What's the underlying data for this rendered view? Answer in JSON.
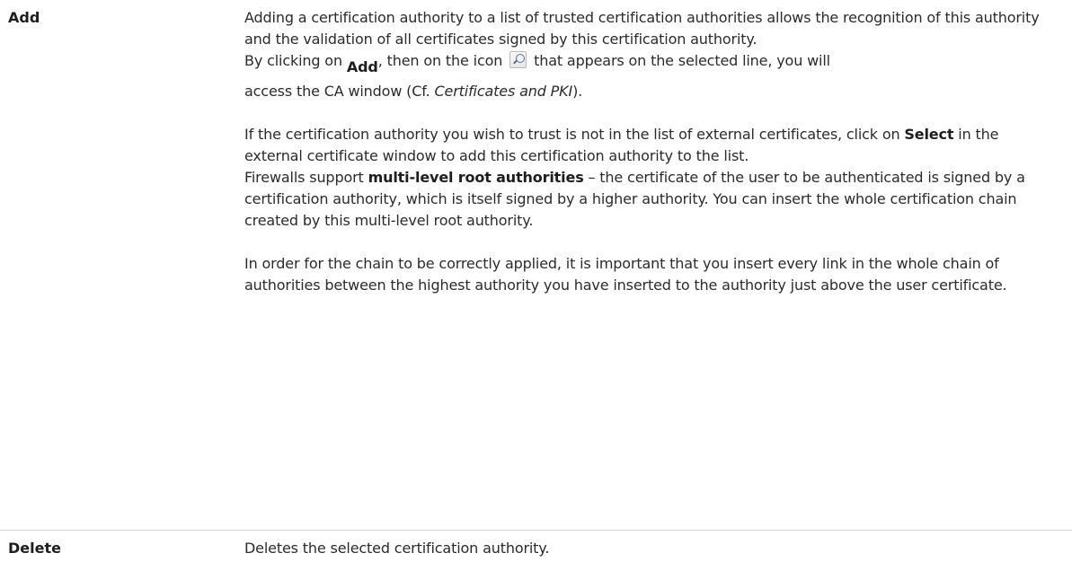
{
  "rows": [
    {
      "term": "Add",
      "p1": "Adding a certification authority to a list of trusted certification authorities allows the recognition of this authority and the validation of all certificates signed by this certification authority.",
      "p2_before": "By clicking on ",
      "p2_add": "Add",
      "p2_after_add": ", then on the icon ",
      "p2_after_icon": " that appears on the selected line, you will",
      "p3_before": "access the CA window (Cf. ",
      "p3_italic": "Certificates and PKI",
      "p3_after": ").",
      "p4_before": "If the certification authority you wish to trust is not in the list of external certificates, click on ",
      "p4_bold": "Select",
      "p4_after": " in the external certificate window to add this certification authority to the list.",
      "p5_before": "Firewalls support ",
      "p5_bold": "multi-level root authorities",
      "p5_after": " – the certificate of the user to be authenticated is signed by a certification authority, which is itself signed by a higher authority. You can insert the whole certification chain created by this multi-level root authority.",
      "p6": "In order for the chain to be correctly applied, it is important that you insert every link in the whole chain of authorities between the highest authority you have inserted to the authority just above the user certificate.",
      "icon": "search-icon"
    },
    {
      "term": "Delete",
      "desc": "Deletes the selected certification authority."
    }
  ]
}
